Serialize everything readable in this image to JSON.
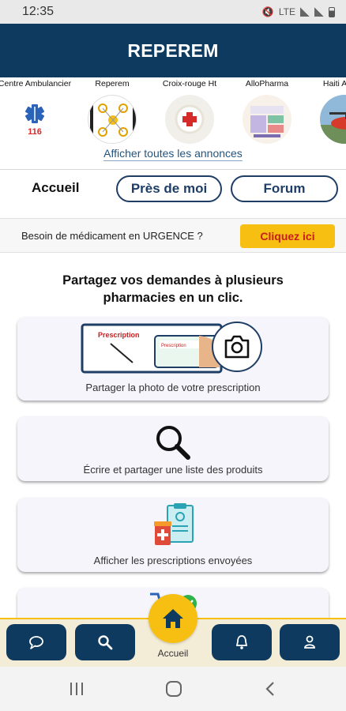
{
  "status_bar": {
    "time": "12:35",
    "network": "LTE"
  },
  "app_bar": {
    "title": "REPEREM"
  },
  "announcements": {
    "items": [
      {
        "label": "Centre Ambulancier",
        "badge": "116"
      },
      {
        "label": "Reperem"
      },
      {
        "label": "Croix-rouge Ht"
      },
      {
        "label": "AlloPharma"
      },
      {
        "label": "Haiti Air Am"
      }
    ],
    "show_all_label": "Afficher toutes les annonces"
  },
  "tabs": {
    "home_label": "Accueil",
    "near_me_label": "Près de moi",
    "forum_label": "Forum"
  },
  "urgent": {
    "text": "Besoin de médicament en URGENCE ?",
    "button_label": "Cliquez ici"
  },
  "main": {
    "headline_line1": "Partagez vos demandes à plusieurs",
    "headline_line2": "pharmacies en un clic.",
    "cards": [
      {
        "label": "Partager la photo de votre prescription",
        "icon": "camera-icon",
        "image_text_1": "Prescription",
        "image_text_2": "Prescription"
      },
      {
        "label": "Écrire et partager une liste des produits",
        "icon": "search-icon"
      },
      {
        "label": "Afficher les prescriptions envoyées",
        "icon": "prescriptions-icon"
      }
    ]
  },
  "bottom_nav": {
    "home_label": "Accueil",
    "items": [
      "chat-icon",
      "search-icon",
      "home-icon",
      "bell-icon",
      "user-icon"
    ]
  },
  "colors": {
    "primary": "#0d3a5e",
    "accent": "#f6bf12",
    "urgent_text": "#c81e1e",
    "link": "#24557f"
  }
}
